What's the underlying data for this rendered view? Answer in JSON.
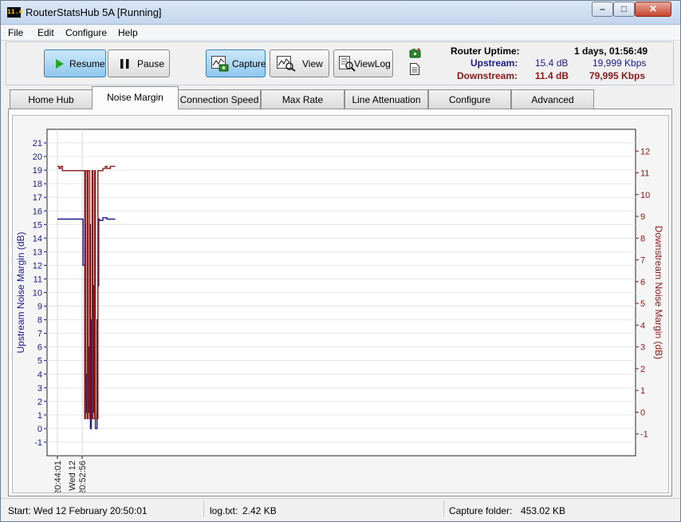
{
  "window": {
    "app_icon_text": "11.4",
    "title": "RouterStatsHub 5A  [Running]",
    "minimize_glyph": "–",
    "maximize_glyph": "□",
    "close_glyph": "✕"
  },
  "menu": [
    "File",
    "Edit",
    "Configure",
    "Help"
  ],
  "toolbar": {
    "resume_label": "Resume",
    "pause_label": "Pause",
    "capture_label": "Capture",
    "view_label": "View",
    "viewlog_label": "ViewLog"
  },
  "status": {
    "uptime_label": "Router Uptime:",
    "uptime_value": "1 days, 01:56:49",
    "upstream_label": "Upstream:",
    "upstream_db": "15.4 dB",
    "upstream_rate": "19,999 Kbps",
    "downstream_label": "Downstream:",
    "downstream_db": "11.4 dB",
    "downstream_rate": "79,995 Kbps",
    "upstream_color": "#1a1a8c",
    "downstream_color": "#8b1a1a"
  },
  "tabs": [
    "Home Hub",
    "Noise Margin",
    "Connection Speed",
    "Max Rate",
    "Line Attenuation",
    "Configure",
    "Advanced"
  ],
  "selected_tab": "Noise Margin",
  "chart_data": {
    "type": "line",
    "ylabel_left": "Upstream Noise Margin (dB)",
    "ylabel_right": "Downstream Noise Margin (dB)",
    "ylim_left": [
      -2,
      22
    ],
    "ylim_right": [
      -2,
      13
    ],
    "yticks_left": [
      -1,
      0,
      1,
      2,
      3,
      4,
      5,
      6,
      7,
      8,
      9,
      10,
      11,
      12,
      13,
      14,
      15,
      16,
      17,
      18,
      19,
      20,
      21
    ],
    "yticks_right": [
      -1,
      0,
      1,
      2,
      3,
      4,
      5,
      6,
      7,
      8,
      9,
      10,
      11,
      12
    ],
    "x_tick_labels": [
      "20:44:01",
      "Wed 12 20:52:56"
    ],
    "x_tick_label_parts": [
      [
        "20:44:01"
      ],
      [
        "Wed 12",
        "20:52:56"
      ]
    ],
    "grid": true,
    "series": [
      {
        "name": "Upstream",
        "axis": "left",
        "color": "#1a1a8c",
        "x": [
          0,
          30,
          31,
          33,
          34,
          35,
          36,
          38,
          39,
          40,
          41,
          43,
          44,
          45,
          46,
          48,
          49,
          50,
          51,
          55,
          60,
          70
        ],
        "y": [
          15.4,
          15.4,
          12,
          15,
          4,
          1.2,
          6,
          1.2,
          15,
          0,
          8,
          1.2,
          10.5,
          1.2,
          0,
          8,
          10.5,
          15.4,
          15.3,
          15.5,
          15.4,
          15.4
        ]
      },
      {
        "name": "Downstream",
        "axis": "right",
        "color": "#8b1a1a",
        "x": [
          0,
          2,
          4,
          6,
          8,
          30,
          31,
          33,
          34,
          36,
          37,
          39,
          40,
          42,
          43,
          45,
          46,
          48,
          49,
          52,
          55,
          58,
          60,
          64,
          68,
          70
        ],
        "y": [
          11.3,
          11.2,
          11.3,
          11.1,
          11.1,
          11.1,
          11.1,
          -0.3,
          11.1,
          -0.3,
          11.1,
          -0.3,
          -0.3,
          11.1,
          -0.3,
          11.1,
          -0.3,
          -0.3,
          11.1,
          11.1,
          11.2,
          11.3,
          11.2,
          11.3,
          11.3,
          11.3
        ]
      }
    ]
  },
  "statusbar": {
    "start_text": "Start: Wed 12 February 20:50:01",
    "log_label": "log.txt:",
    "log_size": "2.42 KB",
    "capture_label": "Capture folder:",
    "capture_size": "453.02 KB"
  }
}
